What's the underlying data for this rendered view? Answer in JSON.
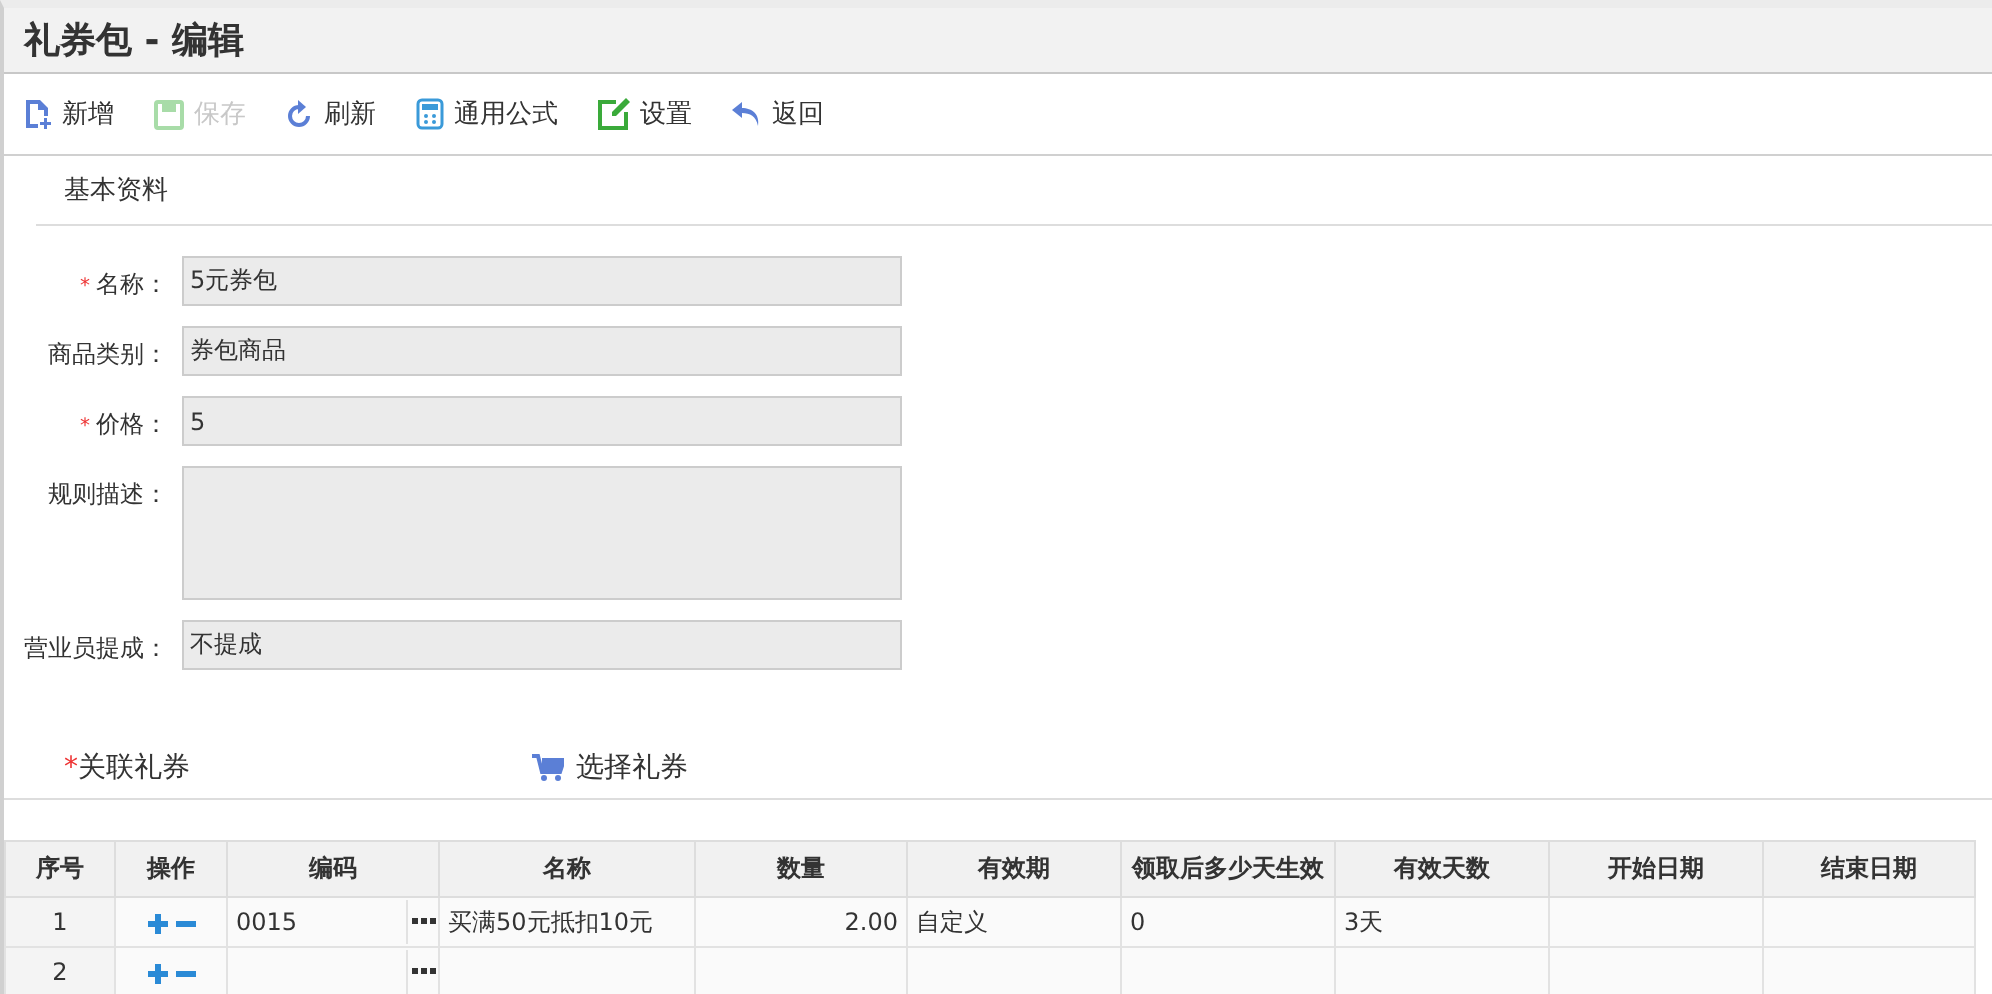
{
  "title": "礼券包 - 编辑",
  "toolbar": [
    {
      "kind": "new",
      "label": "新增",
      "disabled": false
    },
    {
      "kind": "save",
      "label": "保存",
      "disabled": true
    },
    {
      "kind": "refresh",
      "label": "刷新",
      "disabled": false
    },
    {
      "kind": "formula",
      "label": "通用公式",
      "disabled": false
    },
    {
      "kind": "settings",
      "label": "设置",
      "disabled": false
    },
    {
      "kind": "back",
      "label": "返回",
      "disabled": false
    }
  ],
  "section": "基本资料",
  "fields": [
    {
      "label": "名称：",
      "required_mark": "*",
      "value": "5元券包",
      "kind": "input"
    },
    {
      "label": "商品类别：",
      "value": "券包商品",
      "kind": "input"
    },
    {
      "label": "价格：",
      "required_mark": "*",
      "value": "5",
      "kind": "input"
    },
    {
      "label": "规则描述：",
      "kind": "textarea"
    },
    {
      "label": "营业员提成：",
      "value": "不提成",
      "kind": "input"
    }
  ],
  "related": {
    "label": "关联礼券",
    "required_mark": "*",
    "select_button": "选择礼券"
  },
  "table": {
    "columns": [
      "序号",
      "操作",
      "编码",
      "名称",
      "数量",
      "有效期",
      "领取后多少天生效",
      "有效天数",
      "开始日期",
      "结束日期"
    ],
    "rows": [
      {
        "index": "1",
        "code": "0015",
        "name": "买满50元抵扣10元",
        "quantity": "2.00",
        "validity": "自定义",
        "delay_days": "0",
        "valid_days": "3天"
      },
      {
        "index": "2"
      }
    ]
  }
}
